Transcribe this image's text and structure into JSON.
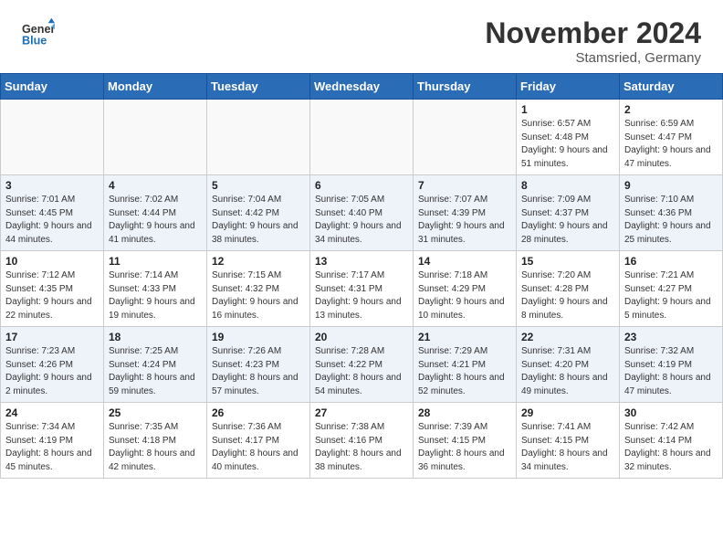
{
  "header": {
    "logo_general": "General",
    "logo_blue": "Blue",
    "month_year": "November 2024",
    "location": "Stamsried, Germany"
  },
  "days_of_week": [
    "Sunday",
    "Monday",
    "Tuesday",
    "Wednesday",
    "Thursday",
    "Friday",
    "Saturday"
  ],
  "weeks": [
    {
      "row_class": "row-even",
      "days": [
        {
          "num": "",
          "detail": "",
          "empty": true
        },
        {
          "num": "",
          "detail": "",
          "empty": true
        },
        {
          "num": "",
          "detail": "",
          "empty": true
        },
        {
          "num": "",
          "detail": "",
          "empty": true
        },
        {
          "num": "",
          "detail": "",
          "empty": true
        },
        {
          "num": "1",
          "detail": "Sunrise: 6:57 AM\nSunset: 4:48 PM\nDaylight: 9 hours and 51 minutes.",
          "empty": false
        },
        {
          "num": "2",
          "detail": "Sunrise: 6:59 AM\nSunset: 4:47 PM\nDaylight: 9 hours and 47 minutes.",
          "empty": false
        }
      ]
    },
    {
      "row_class": "row-odd",
      "days": [
        {
          "num": "3",
          "detail": "Sunrise: 7:01 AM\nSunset: 4:45 PM\nDaylight: 9 hours and 44 minutes.",
          "empty": false
        },
        {
          "num": "4",
          "detail": "Sunrise: 7:02 AM\nSunset: 4:44 PM\nDaylight: 9 hours and 41 minutes.",
          "empty": false
        },
        {
          "num": "5",
          "detail": "Sunrise: 7:04 AM\nSunset: 4:42 PM\nDaylight: 9 hours and 38 minutes.",
          "empty": false
        },
        {
          "num": "6",
          "detail": "Sunrise: 7:05 AM\nSunset: 4:40 PM\nDaylight: 9 hours and 34 minutes.",
          "empty": false
        },
        {
          "num": "7",
          "detail": "Sunrise: 7:07 AM\nSunset: 4:39 PM\nDaylight: 9 hours and 31 minutes.",
          "empty": false
        },
        {
          "num": "8",
          "detail": "Sunrise: 7:09 AM\nSunset: 4:37 PM\nDaylight: 9 hours and 28 minutes.",
          "empty": false
        },
        {
          "num": "9",
          "detail": "Sunrise: 7:10 AM\nSunset: 4:36 PM\nDaylight: 9 hours and 25 minutes.",
          "empty": false
        }
      ]
    },
    {
      "row_class": "row-even",
      "days": [
        {
          "num": "10",
          "detail": "Sunrise: 7:12 AM\nSunset: 4:35 PM\nDaylight: 9 hours and 22 minutes.",
          "empty": false
        },
        {
          "num": "11",
          "detail": "Sunrise: 7:14 AM\nSunset: 4:33 PM\nDaylight: 9 hours and 19 minutes.",
          "empty": false
        },
        {
          "num": "12",
          "detail": "Sunrise: 7:15 AM\nSunset: 4:32 PM\nDaylight: 9 hours and 16 minutes.",
          "empty": false
        },
        {
          "num": "13",
          "detail": "Sunrise: 7:17 AM\nSunset: 4:31 PM\nDaylight: 9 hours and 13 minutes.",
          "empty": false
        },
        {
          "num": "14",
          "detail": "Sunrise: 7:18 AM\nSunset: 4:29 PM\nDaylight: 9 hours and 10 minutes.",
          "empty": false
        },
        {
          "num": "15",
          "detail": "Sunrise: 7:20 AM\nSunset: 4:28 PM\nDaylight: 9 hours and 8 minutes.",
          "empty": false
        },
        {
          "num": "16",
          "detail": "Sunrise: 7:21 AM\nSunset: 4:27 PM\nDaylight: 9 hours and 5 minutes.",
          "empty": false
        }
      ]
    },
    {
      "row_class": "row-odd",
      "days": [
        {
          "num": "17",
          "detail": "Sunrise: 7:23 AM\nSunset: 4:26 PM\nDaylight: 9 hours and 2 minutes.",
          "empty": false
        },
        {
          "num": "18",
          "detail": "Sunrise: 7:25 AM\nSunset: 4:24 PM\nDaylight: 8 hours and 59 minutes.",
          "empty": false
        },
        {
          "num": "19",
          "detail": "Sunrise: 7:26 AM\nSunset: 4:23 PM\nDaylight: 8 hours and 57 minutes.",
          "empty": false
        },
        {
          "num": "20",
          "detail": "Sunrise: 7:28 AM\nSunset: 4:22 PM\nDaylight: 8 hours and 54 minutes.",
          "empty": false
        },
        {
          "num": "21",
          "detail": "Sunrise: 7:29 AM\nSunset: 4:21 PM\nDaylight: 8 hours and 52 minutes.",
          "empty": false
        },
        {
          "num": "22",
          "detail": "Sunrise: 7:31 AM\nSunset: 4:20 PM\nDaylight: 8 hours and 49 minutes.",
          "empty": false
        },
        {
          "num": "23",
          "detail": "Sunrise: 7:32 AM\nSunset: 4:19 PM\nDaylight: 8 hours and 47 minutes.",
          "empty": false
        }
      ]
    },
    {
      "row_class": "row-even",
      "days": [
        {
          "num": "24",
          "detail": "Sunrise: 7:34 AM\nSunset: 4:19 PM\nDaylight: 8 hours and 45 minutes.",
          "empty": false
        },
        {
          "num": "25",
          "detail": "Sunrise: 7:35 AM\nSunset: 4:18 PM\nDaylight: 8 hours and 42 minutes.",
          "empty": false
        },
        {
          "num": "26",
          "detail": "Sunrise: 7:36 AM\nSunset: 4:17 PM\nDaylight: 8 hours and 40 minutes.",
          "empty": false
        },
        {
          "num": "27",
          "detail": "Sunrise: 7:38 AM\nSunset: 4:16 PM\nDaylight: 8 hours and 38 minutes.",
          "empty": false
        },
        {
          "num": "28",
          "detail": "Sunrise: 7:39 AM\nSunset: 4:15 PM\nDaylight: 8 hours and 36 minutes.",
          "empty": false
        },
        {
          "num": "29",
          "detail": "Sunrise: 7:41 AM\nSunset: 4:15 PM\nDaylight: 8 hours and 34 minutes.",
          "empty": false
        },
        {
          "num": "30",
          "detail": "Sunrise: 7:42 AM\nSunset: 4:14 PM\nDaylight: 8 hours and 32 minutes.",
          "empty": false
        }
      ]
    }
  ]
}
